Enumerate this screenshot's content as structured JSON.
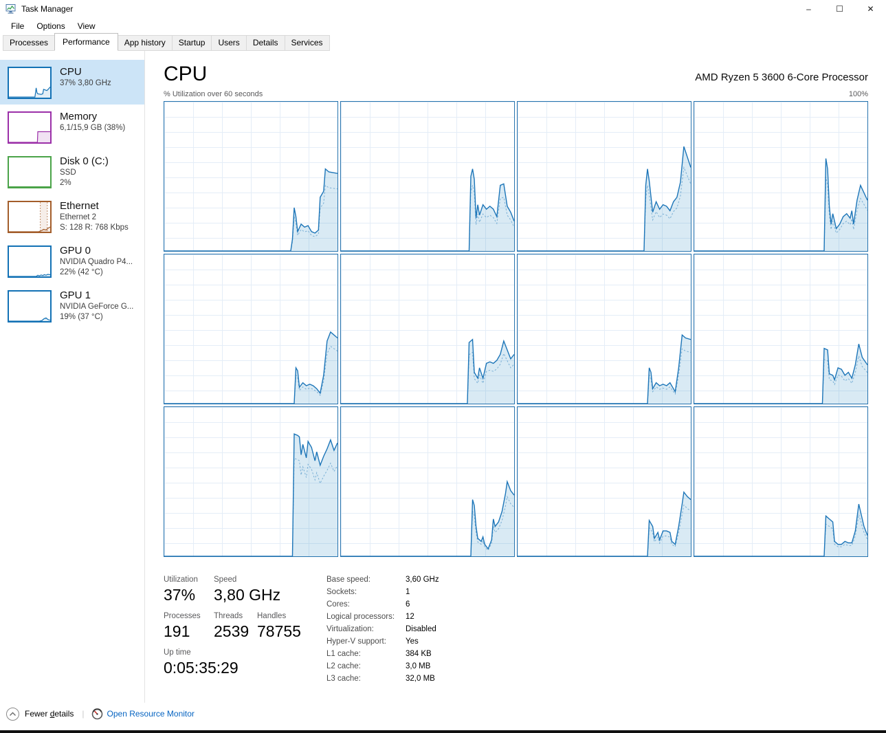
{
  "window": {
    "title": "Task Manager",
    "controls": {
      "minimize": "–",
      "maximize": "☐",
      "close": "✕"
    }
  },
  "menu": {
    "items": [
      "File",
      "Options",
      "View"
    ]
  },
  "tabs": {
    "active_index": 1,
    "items": [
      "Processes",
      "Performance",
      "App history",
      "Startup",
      "Users",
      "Details",
      "Services"
    ]
  },
  "sidebar": {
    "items": [
      {
        "id": "cpu",
        "title": "CPU",
        "subtitles": [
          "37% 3,80 GHz"
        ],
        "color": "#1271b5",
        "fill": "rgba(18,113,181,0.12)",
        "selected": true,
        "spark": {
          "points": [
            [
              0,
              2
            ],
            [
              63,
              2
            ],
            [
              65,
              22
            ],
            [
              66,
              33
            ],
            [
              68,
              17
            ],
            [
              70,
              13
            ],
            [
              74,
              12
            ],
            [
              78,
              11
            ],
            [
              82,
              13
            ],
            [
              84,
              28
            ],
            [
              88,
              26
            ],
            [
              92,
              24
            ],
            [
              95,
              28
            ],
            [
              100,
              36
            ]
          ]
        }
      },
      {
        "id": "memory",
        "title": "Memory",
        "subtitles": [
          "6,1/15,9 GB (38%)"
        ],
        "color": "#9b2fa8",
        "fill": "rgba(155,47,168,0.14)",
        "selected": false,
        "spark": {
          "points": [
            [
              0,
              0
            ],
            [
              69,
              0
            ],
            [
              70,
              36
            ],
            [
              100,
              36
            ]
          ]
        }
      },
      {
        "id": "disk-0",
        "title": "Disk 0 (C:)",
        "subtitles": [
          "SSD",
          "2%"
        ],
        "color": "#4aa348",
        "fill": "rgba(74,163,72,0.12)",
        "selected": false,
        "spark": {
          "points": [
            [
              0,
              1
            ],
            [
              100,
              1
            ]
          ]
        }
      },
      {
        "id": "ethernet",
        "title": "Ethernet",
        "subtitles": [
          "Ethernet 2",
          "S: 128 R: 768 Kbps"
        ],
        "color": "#a35d2a",
        "fill": "rgba(163,93,42,0.10)",
        "selected": false,
        "spark": {
          "points": [
            [
              0,
              0
            ],
            [
              72,
              0
            ],
            [
              78,
              3
            ],
            [
              84,
              8
            ],
            [
              90,
              6
            ],
            [
              95,
              12
            ],
            [
              100,
              16
            ]
          ],
          "band": [
            76,
            93
          ]
        }
      },
      {
        "id": "gpu-0",
        "title": "GPU 0",
        "subtitles": [
          "NVIDIA Quadro P4...",
          "22% (42 °C)"
        ],
        "color": "#1271b5",
        "fill": "rgba(18,113,181,0.12)",
        "selected": false,
        "spark": {
          "points": [
            [
              0,
              0
            ],
            [
              66,
              0
            ],
            [
              70,
              4
            ],
            [
              74,
              2
            ],
            [
              78,
              5
            ],
            [
              82,
              3
            ],
            [
              86,
              6
            ],
            [
              90,
              4
            ],
            [
              94,
              7
            ],
            [
              100,
              6
            ]
          ]
        }
      },
      {
        "id": "gpu-1",
        "title": "GPU 1",
        "subtitles": [
          "NVIDIA GeForce G...",
          "19% (37 °C)"
        ],
        "color": "#1271b5",
        "fill": "rgba(18,113,181,0.12)",
        "selected": false,
        "spark": {
          "points": [
            [
              0,
              0
            ],
            [
              74,
              0
            ],
            [
              80,
              2
            ],
            [
              85,
              8
            ],
            [
              90,
              11
            ],
            [
              95,
              5
            ],
            [
              100,
              3
            ]
          ]
        }
      }
    ]
  },
  "main": {
    "title": "CPU",
    "processor": "AMD Ryzen 5 3600 6-Core Processor",
    "chart_caption": "% Utilization over 60 seconds",
    "chart_max_label": "100%"
  },
  "chart_data": {
    "type": "area",
    "title": "CPU % Utilization over 60 seconds, one graph per logical processor",
    "x_range_seconds": 60,
    "ylim": [
      0,
      100
    ],
    "grid": true,
    "legend": "none",
    "series": [
      {
        "name": "logical-processor-1",
        "points": [
          [
            0,
            0
          ],
          [
            73,
            0
          ],
          [
            74,
            8
          ],
          [
            75,
            29
          ],
          [
            76,
            23
          ],
          [
            77,
            13
          ],
          [
            79,
            18
          ],
          [
            81,
            16
          ],
          [
            83,
            17
          ],
          [
            85,
            13
          ],
          [
            87,
            12
          ],
          [
            89,
            14
          ],
          [
            90,
            36
          ],
          [
            92,
            40
          ],
          [
            93,
            55
          ],
          [
            95,
            53
          ],
          [
            100,
            52
          ]
        ]
      },
      {
        "name": "logical-processor-2",
        "points": [
          [
            0,
            0
          ],
          [
            74,
            0
          ],
          [
            75,
            50
          ],
          [
            76,
            55
          ],
          [
            77,
            48
          ],
          [
            78,
            22
          ],
          [
            79,
            31
          ],
          [
            80,
            24
          ],
          [
            82,
            31
          ],
          [
            84,
            28
          ],
          [
            86,
            30
          ],
          [
            88,
            28
          ],
          [
            90,
            23
          ],
          [
            92,
            44
          ],
          [
            94,
            45
          ],
          [
            96,
            30
          ],
          [
            98,
            26
          ],
          [
            100,
            20
          ]
        ]
      },
      {
        "name": "logical-processor-3",
        "points": [
          [
            0,
            0
          ],
          [
            73,
            0
          ],
          [
            74,
            44
          ],
          [
            75,
            55
          ],
          [
            76,
            47
          ],
          [
            78,
            26
          ],
          [
            80,
            33
          ],
          [
            82,
            28
          ],
          [
            84,
            31
          ],
          [
            86,
            30
          ],
          [
            88,
            27
          ],
          [
            90,
            33
          ],
          [
            92,
            36
          ],
          [
            94,
            46
          ],
          [
            96,
            70
          ],
          [
            98,
            63
          ],
          [
            100,
            56
          ]
        ]
      },
      {
        "name": "logical-processor-4",
        "points": [
          [
            0,
            0
          ],
          [
            75,
            0
          ],
          [
            76,
            62
          ],
          [
            77,
            55
          ],
          [
            78,
            30
          ],
          [
            79,
            18
          ],
          [
            80,
            25
          ],
          [
            82,
            15
          ],
          [
            84,
            18
          ],
          [
            86,
            23
          ],
          [
            88,
            25
          ],
          [
            90,
            22
          ],
          [
            91,
            27
          ],
          [
            92,
            18
          ],
          [
            94,
            34
          ],
          [
            96,
            44
          ],
          [
            98,
            39
          ],
          [
            100,
            34
          ]
        ]
      },
      {
        "name": "logical-processor-5",
        "points": [
          [
            0,
            0
          ],
          [
            75,
            0
          ],
          [
            76,
            24
          ],
          [
            77,
            22
          ],
          [
            78,
            11
          ],
          [
            80,
            14
          ],
          [
            82,
            12
          ],
          [
            84,
            13
          ],
          [
            86,
            12
          ],
          [
            88,
            10
          ],
          [
            90,
            7
          ],
          [
            92,
            19
          ],
          [
            94,
            42
          ],
          [
            96,
            48
          ],
          [
            98,
            46
          ],
          [
            100,
            44
          ]
        ]
      },
      {
        "name": "logical-processor-6",
        "points": [
          [
            0,
            0
          ],
          [
            73,
            0
          ],
          [
            74,
            41
          ],
          [
            76,
            43
          ],
          [
            77,
            21
          ],
          [
            79,
            17
          ],
          [
            80,
            24
          ],
          [
            82,
            17
          ],
          [
            84,
            27
          ],
          [
            86,
            28
          ],
          [
            88,
            27
          ],
          [
            90,
            29
          ],
          [
            92,
            33
          ],
          [
            94,
            42
          ],
          [
            96,
            36
          ],
          [
            98,
            30
          ],
          [
            100,
            33
          ]
        ]
      },
      {
        "name": "logical-processor-7",
        "points": [
          [
            0,
            0
          ],
          [
            75,
            0
          ],
          [
            76,
            24
          ],
          [
            77,
            21
          ],
          [
            78,
            10
          ],
          [
            80,
            14
          ],
          [
            82,
            12
          ],
          [
            84,
            13
          ],
          [
            86,
            12
          ],
          [
            88,
            14
          ],
          [
            90,
            10
          ],
          [
            91,
            8
          ],
          [
            93,
            24
          ],
          [
            95,
            46
          ],
          [
            97,
            44
          ],
          [
            100,
            43
          ]
        ]
      },
      {
        "name": "logical-processor-8",
        "points": [
          [
            0,
            0
          ],
          [
            74,
            0
          ],
          [
            75,
            37
          ],
          [
            77,
            36
          ],
          [
            78,
            20
          ],
          [
            80,
            19
          ],
          [
            81,
            16
          ],
          [
            83,
            24
          ],
          [
            85,
            23
          ],
          [
            87,
            19
          ],
          [
            89,
            21
          ],
          [
            91,
            17
          ],
          [
            93,
            26
          ],
          [
            95,
            40
          ],
          [
            97,
            31
          ],
          [
            100,
            26
          ]
        ]
      },
      {
        "name": "logical-processor-9",
        "points": [
          [
            0,
            0
          ],
          [
            74,
            0
          ],
          [
            75,
            82
          ],
          [
            77,
            81
          ],
          [
            78,
            80
          ],
          [
            79,
            68
          ],
          [
            80,
            75
          ],
          [
            82,
            66
          ],
          [
            83,
            77
          ],
          [
            85,
            73
          ],
          [
            87,
            64
          ],
          [
            88,
            70
          ],
          [
            90,
            61
          ],
          [
            92,
            67
          ],
          [
            94,
            72
          ],
          [
            96,
            78
          ],
          [
            98,
            71
          ],
          [
            100,
            76
          ]
        ]
      },
      {
        "name": "logical-processor-10",
        "points": [
          [
            0,
            0
          ],
          [
            75,
            0
          ],
          [
            76,
            38
          ],
          [
            77,
            34
          ],
          [
            78,
            20
          ],
          [
            79,
            12
          ],
          [
            81,
            10
          ],
          [
            82,
            13
          ],
          [
            83,
            8
          ],
          [
            85,
            5
          ],
          [
            87,
            11
          ],
          [
            88,
            25
          ],
          [
            89,
            20
          ],
          [
            91,
            23
          ],
          [
            93,
            30
          ],
          [
            95,
            42
          ],
          [
            96,
            50
          ],
          [
            98,
            44
          ],
          [
            100,
            41
          ]
        ]
      },
      {
        "name": "logical-processor-11",
        "points": [
          [
            0,
            0
          ],
          [
            75,
            0
          ],
          [
            76,
            24
          ],
          [
            78,
            20
          ],
          [
            79,
            12
          ],
          [
            81,
            16
          ],
          [
            82,
            11
          ],
          [
            84,
            17
          ],
          [
            86,
            17
          ],
          [
            88,
            16
          ],
          [
            89,
            10
          ],
          [
            91,
            8
          ],
          [
            93,
            20
          ],
          [
            95,
            35
          ],
          [
            96,
            43
          ],
          [
            98,
            40
          ],
          [
            100,
            38
          ]
        ]
      },
      {
        "name": "logical-processor-12",
        "points": [
          [
            0,
            0
          ],
          [
            75,
            0
          ],
          [
            76,
            27
          ],
          [
            78,
            25
          ],
          [
            80,
            23
          ],
          [
            81,
            10
          ],
          [
            83,
            8
          ],
          [
            85,
            8
          ],
          [
            87,
            10
          ],
          [
            89,
            9
          ],
          [
            91,
            9
          ],
          [
            93,
            17
          ],
          [
            95,
            35
          ],
          [
            96,
            30
          ],
          [
            98,
            20
          ],
          [
            100,
            14
          ]
        ]
      }
    ]
  },
  "stats": {
    "big": [
      {
        "label": "Utilization",
        "value": "37%"
      },
      {
        "label": "Speed",
        "value": "3,80 GHz"
      },
      {
        "label": "Processes",
        "value": "191"
      },
      {
        "label": "Threads",
        "value": "2539"
      },
      {
        "label": "Handles",
        "value": "78755"
      },
      {
        "label": "Up time",
        "value": "0:05:35:29"
      }
    ],
    "details": [
      {
        "label": "Base speed:",
        "value": "3,60 GHz"
      },
      {
        "label": "Sockets:",
        "value": "1"
      },
      {
        "label": "Cores:",
        "value": "6"
      },
      {
        "label": "Logical processors:",
        "value": "12"
      },
      {
        "label": "Virtualization:",
        "value": "Disabled"
      },
      {
        "label": "Hyper-V support:",
        "value": "Yes"
      },
      {
        "label": "L1 cache:",
        "value": "384 KB"
      },
      {
        "label": "L2 cache:",
        "value": "3,0 MB"
      },
      {
        "label": "L3 cache:",
        "value": "32,0 MB"
      }
    ]
  },
  "footer": {
    "fewer_details": {
      "pre": "Fewer ",
      "underlined": "d",
      "post": "etails"
    },
    "open_resource_monitor": "Open Resource Monitor"
  },
  "colors": {
    "accent_blue": "#1271b5",
    "chart_line": "#1c75b8",
    "chart_kernel_line": "rgba(28,117,184,0.5)",
    "chart_border": "#2673ae",
    "chart_fill": "rgba(17,125,187,0.16)",
    "grid_line": "#e4edf7",
    "selected_item_bg": "#cce4f7",
    "memory_purple": "#9b2fa8",
    "disk_green": "#4aa348",
    "ethernet_brown": "#a35d2a",
    "link_blue": "#0563c1",
    "muted_text": "#58585a"
  }
}
